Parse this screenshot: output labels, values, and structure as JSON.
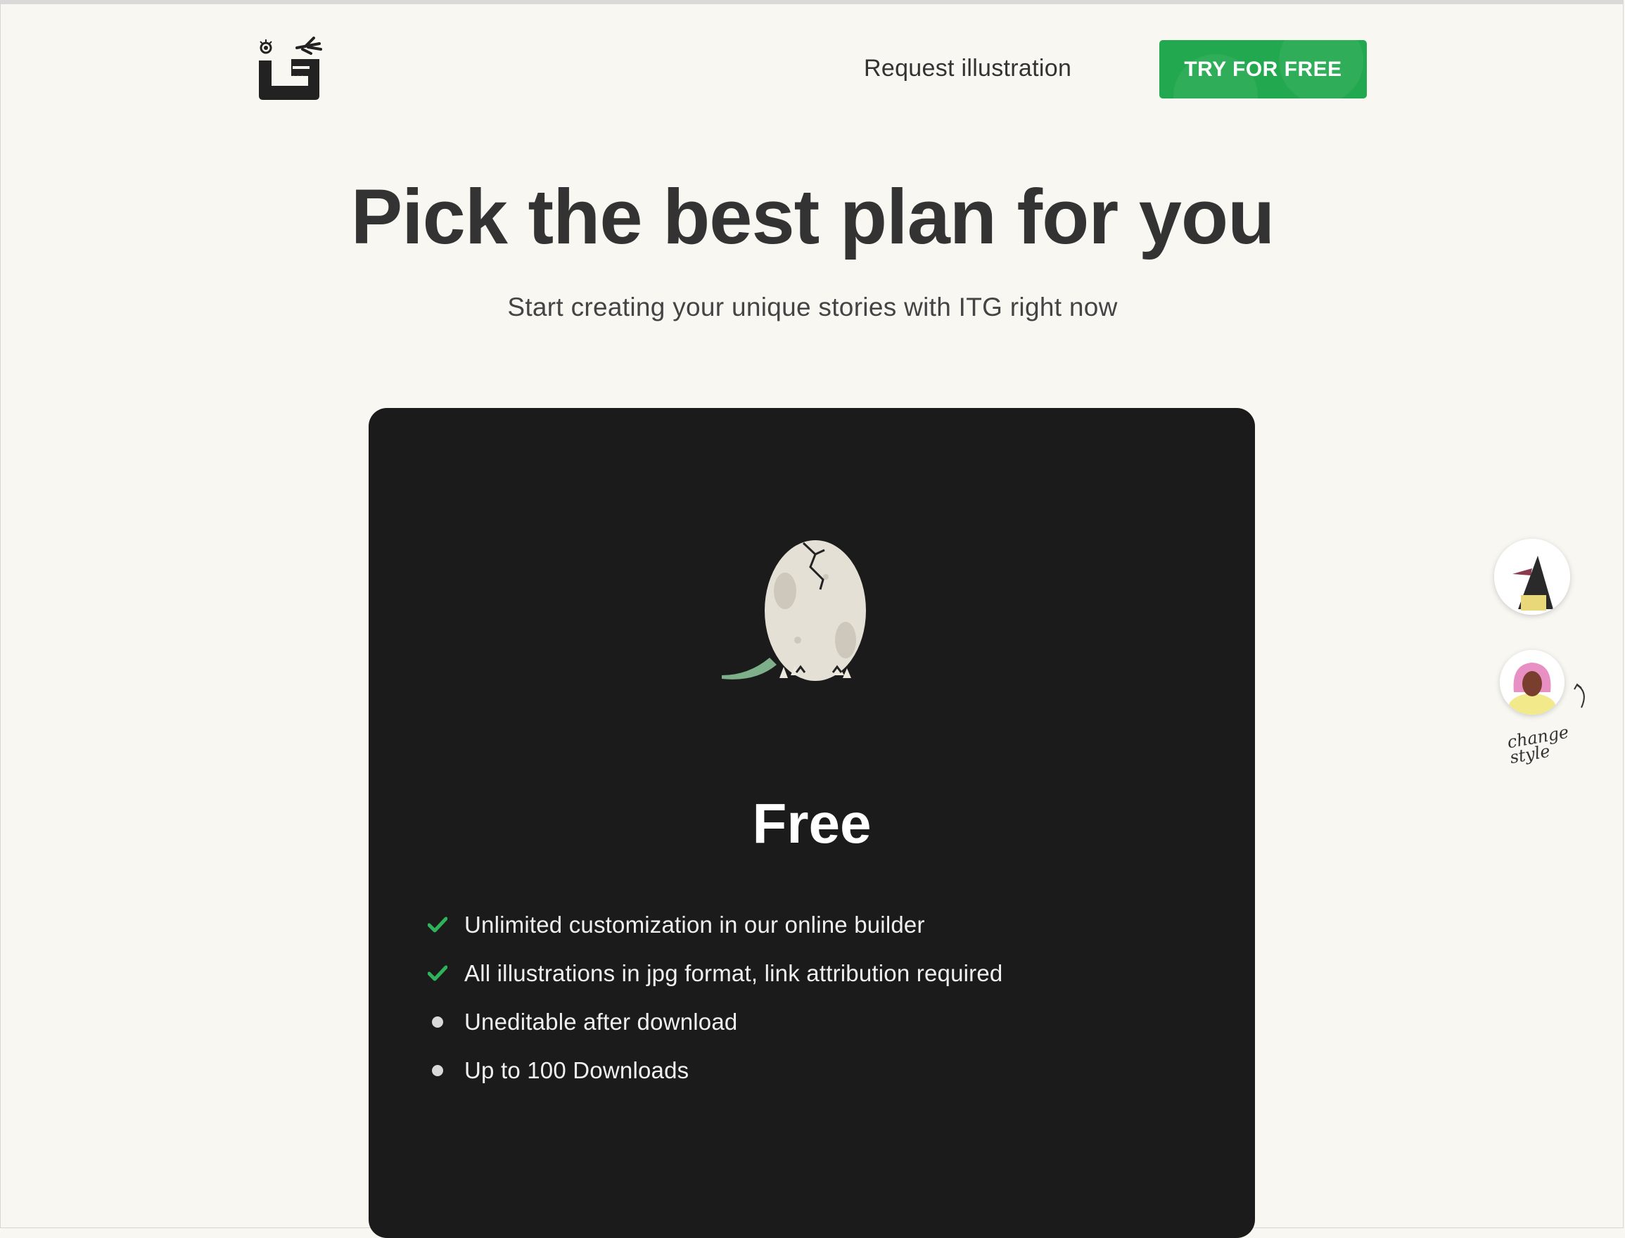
{
  "header": {
    "logo_icon": "itg-logo-icon",
    "nav_link_label": "Request illustration",
    "cta_label": "TRY FOR FREE",
    "cta_color": "#22a84f"
  },
  "hero": {
    "title": "Pick the best plan for you",
    "subtitle": "Start creating your unique stories with ITG right now"
  },
  "plan": {
    "illustration_icon": "hatching-egg-icon",
    "name": "Free",
    "card_color": "#1b1b1b",
    "features": [
      {
        "text": "Unlimited customization in our online builder",
        "icon": "check-icon"
      },
      {
        "text": "All illustrations in jpg format, link attribution required",
        "icon": "check-icon"
      },
      {
        "text": "Uneditable after download",
        "icon": "bullet-icon"
      },
      {
        "text": "Up to 100 Downloads",
        "icon": "bullet-icon"
      }
    ]
  },
  "style_switcher": {
    "label": "change style",
    "options": [
      "style-option-1",
      "style-option-2"
    ]
  }
}
